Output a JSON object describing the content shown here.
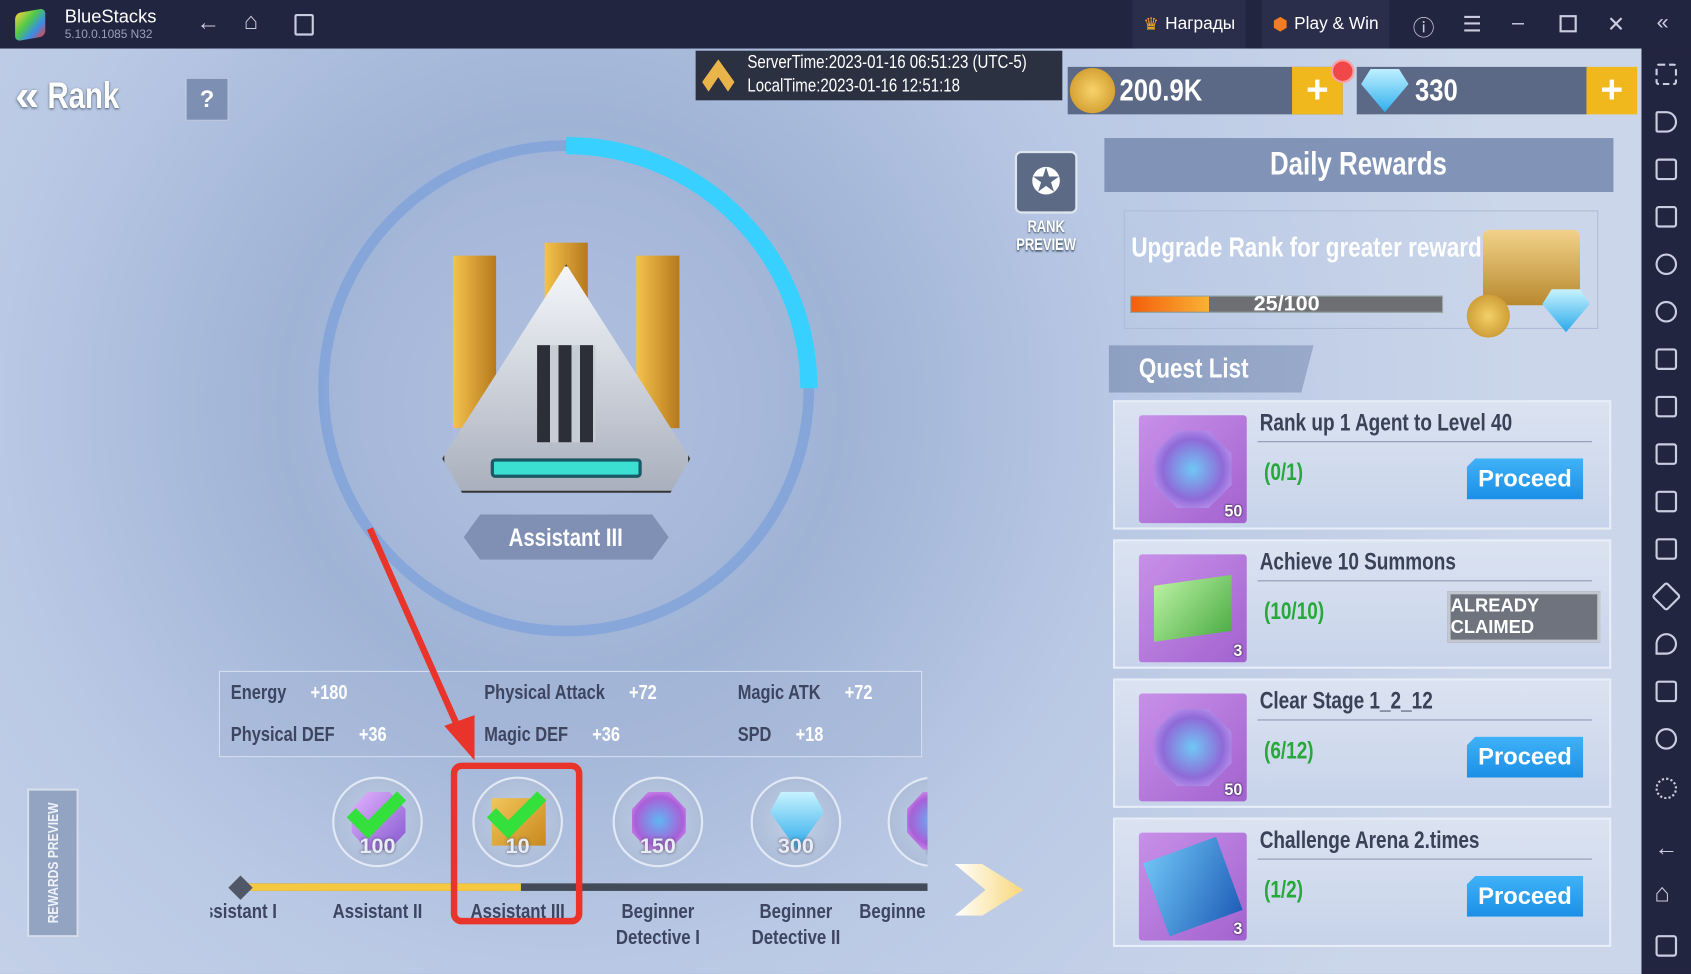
{
  "titlebar": {
    "app_name": "BlueStacks",
    "version": "5.10.0.1085  N32",
    "rewards_label": "Награды",
    "play_win_label": "Play & Win"
  },
  "header": {
    "back_label": "Rank",
    "help_label": "?",
    "server_time": "ServerTime:2023-01-16 06:51:23 (UTC-5)",
    "local_time": "LocalTime:2023-01-16 12:51:18",
    "coins": "200.9K",
    "gems": "330"
  },
  "rank": {
    "current": "Assistant III",
    "preview_label": "RANK PREVIEW",
    "progress_ring": 0.25
  },
  "stats": [
    {
      "name": "Energy",
      "value": "+180"
    },
    {
      "name": "Physical Attack",
      "value": "+72"
    },
    {
      "name": "Magic ATK",
      "value": "+72"
    },
    {
      "name": "Physical DEF",
      "value": "+36"
    },
    {
      "name": "Magic DEF",
      "value": "+36"
    },
    {
      "name": "SPD",
      "value": "+18"
    }
  ],
  "track": {
    "rewards_preview_label": "REWARDS PREVIEW",
    "nodes": [
      {
        "label": "ssistant I"
      },
      {
        "label": "Assistant II",
        "reward": "100",
        "claimed": true
      },
      {
        "label": "Assistant III",
        "reward": "10",
        "claimed": true
      },
      {
        "label": "Beginner Detective I",
        "reward": "150"
      },
      {
        "label": "Beginner Detective II",
        "reward": "300"
      },
      {
        "label": "Beginne",
        "reward": "2"
      }
    ]
  },
  "daily": {
    "title": "Daily Rewards",
    "upgrade_text": "Upgrade Rank for greater rewards!",
    "progress_text": "25/100",
    "progress": 0.25,
    "quest_list_title": "Quest List",
    "quests": [
      {
        "title": "Rank up 1 Agent to Level 40",
        "progress": "(0/1)",
        "reward_count": "50",
        "action": "Proceed"
      },
      {
        "title": "Achieve 10 Summons",
        "progress": "(10/10)",
        "reward_count": "3",
        "action": "ALREADY CLAIMED"
      },
      {
        "title": "Clear Stage 1_2_12",
        "progress": "(6/12)",
        "reward_count": "50",
        "action": "Proceed"
      },
      {
        "title": "Challenge Arena 2.times",
        "progress": "(1/2)",
        "reward_count": "3",
        "action": "Proceed"
      }
    ]
  },
  "colors": {
    "titlebar": "#22253f",
    "proceed": "#1b8fe6",
    "quest_progress": "#26a83a",
    "highlight": "#e8342a",
    "plus_button": "#f0b81c"
  }
}
